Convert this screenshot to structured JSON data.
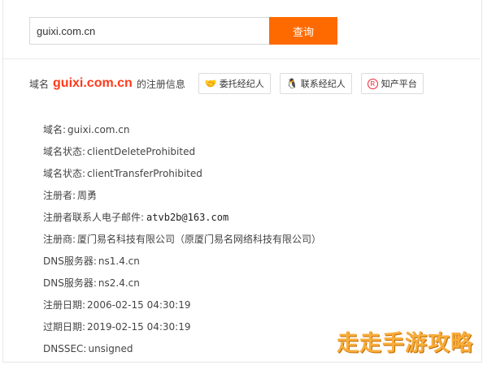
{
  "search": {
    "value": "guixi.com.cn",
    "button_label": "查询"
  },
  "info_header": {
    "prefix": "域名",
    "domain": "guixi.com.cn",
    "suffix": "的注册信息",
    "buttons": [
      {
        "label": "委托经纪人",
        "icon": "handshake-icon"
      },
      {
        "label": "联系经纪人",
        "icon": "qq-icon"
      },
      {
        "label": "知产平台",
        "icon": "registered-icon"
      }
    ]
  },
  "whois": [
    {
      "label": "域名:",
      "value": "guixi.com.cn",
      "mono": false
    },
    {
      "label": "域名状态:",
      "value": "clientDeleteProhibited",
      "mono": false
    },
    {
      "label": "域名状态:",
      "value": "clientTransferProhibited",
      "mono": false
    },
    {
      "label": "注册者:",
      "value": "周勇",
      "mono": false
    },
    {
      "label": "注册者联系人电子邮件:",
      "value": "atvb2b@163.com",
      "mono": true
    },
    {
      "label": "注册商:",
      "value": "厦门易名科技有限公司（原厦门易名网络科技有限公司）",
      "mono": false
    },
    {
      "label": "DNS服务器:",
      "value": "ns1.4.cn",
      "mono": false
    },
    {
      "label": "DNS服务器:",
      "value": "ns2.4.cn",
      "mono": false
    },
    {
      "label": "注册日期:",
      "value": "2006-02-15 04:30:19",
      "mono": false
    },
    {
      "label": "过期日期:",
      "value": "2019-02-15 04:30:19",
      "mono": false
    },
    {
      "label": "DNSSEC:",
      "value": "unsigned",
      "mono": false
    }
  ],
  "watermark": "走走手游攻略",
  "colors": {
    "accent": "#ff6a00",
    "domain": "#ff3a1a",
    "watermark": "#f8ad3a"
  }
}
